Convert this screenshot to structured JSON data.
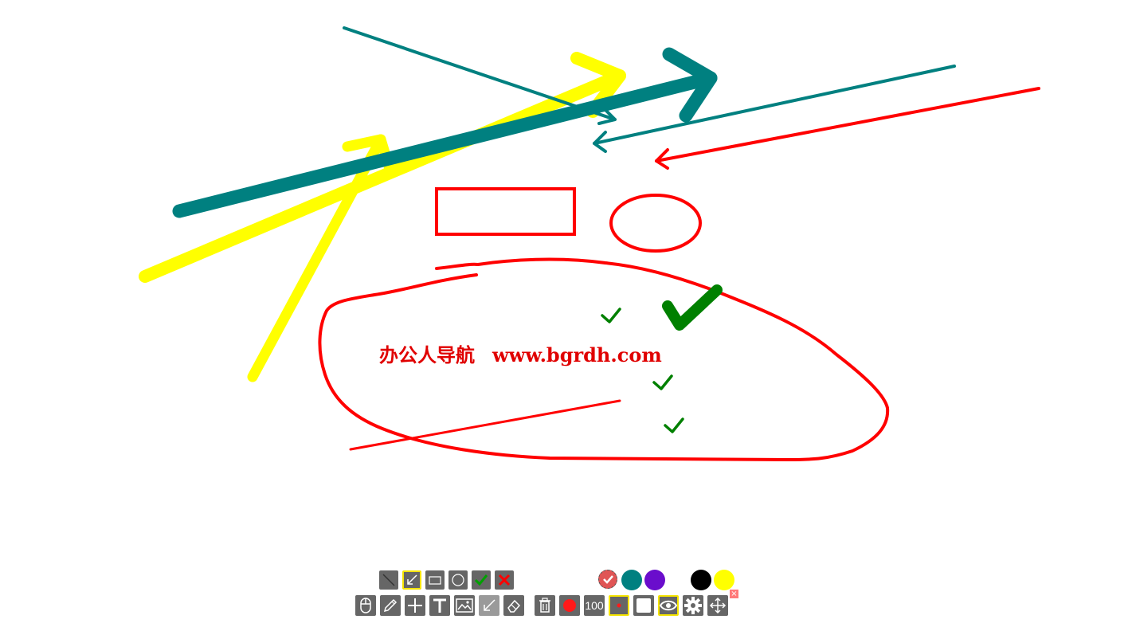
{
  "watermark": {
    "name_text": "办公人导航",
    "url_text": "www.bgrdh.com"
  },
  "colors": {
    "red": "#ff0000",
    "teal": "#008080",
    "yellow": "#ffff00",
    "green": "#008000",
    "purple": "#6a0dcc",
    "black": "#000000",
    "toolbar_gray": "#666666",
    "selected_border": "#f5e400"
  },
  "toolbar": {
    "shape_tools": [
      {
        "icon": "line-icon",
        "selected": false
      },
      {
        "icon": "arrow-icon",
        "selected": true
      },
      {
        "icon": "rectangle-icon",
        "selected": false
      },
      {
        "icon": "circle-icon",
        "selected": false
      },
      {
        "icon": "checkmark-icon",
        "selected": false
      },
      {
        "icon": "cross-icon",
        "selected": false
      }
    ],
    "main_tools": [
      {
        "icon": "mouse-icon"
      },
      {
        "icon": "pencil-icon"
      },
      {
        "icon": "plus-icon"
      },
      {
        "icon": "text-icon",
        "label": "T"
      },
      {
        "icon": "image-icon"
      },
      {
        "icon": "arrow-tool-icon"
      },
      {
        "icon": "eraser-icon"
      },
      {
        "icon": "trash-icon"
      },
      {
        "icon": "red-dot-icon"
      },
      {
        "icon": "opacity-icon"
      },
      {
        "icon": "brush-size-icon"
      },
      {
        "icon": "fill-square-icon"
      },
      {
        "icon": "eye-icon"
      },
      {
        "icon": "gear-icon"
      },
      {
        "icon": "move-icon"
      }
    ],
    "opacity_label": "100",
    "palette": [
      {
        "name": "red-check",
        "color": "#e05555",
        "selected": true
      },
      {
        "name": "teal",
        "color": "#008080"
      },
      {
        "name": "purple",
        "color": "#6a0dcc"
      },
      {
        "name": "black",
        "color": "#000000"
      },
      {
        "name": "yellow",
        "color": "#ffff00"
      }
    ],
    "close_label": "×"
  }
}
